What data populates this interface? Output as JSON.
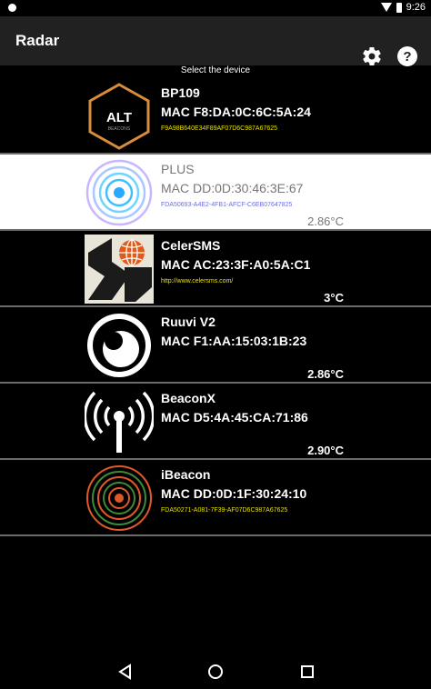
{
  "statusbar": {
    "time": "9:26"
  },
  "appbar": {
    "title": "Radar",
    "icons": [
      "gear-icon",
      "help-icon"
    ]
  },
  "hint": "Select the device",
  "devices": [
    {
      "name": "BP109",
      "mac": "MAC F8:DA:0C:6C:5A:24",
      "extra": "F9A98B640E34F89AF07D6C987A67625",
      "temp": "",
      "icon": "alt-beacons-logo",
      "selected": false,
      "logo_text": "ALT",
      "logo_subtext": "BEACONS"
    },
    {
      "name": "PLUS",
      "mac": "MAC DD:0D:30:46:3E:67",
      "extra": "FDA50693-A4E2-4FB1-AFCF-C6EB07647825",
      "temp": "2.86°C",
      "icon": "pastel-radar-icon",
      "selected": true
    },
    {
      "name": "CelerSMS",
      "mac": "MAC AC:23:3F:A0:5A:C1",
      "extra": "http://www.celersms.com/",
      "temp": "3°C",
      "icon": "celersms-logo",
      "selected": false
    },
    {
      "name": "Ruuvi V2",
      "mac": "MAC F1:AA:15:03:1B:23",
      "extra": "",
      "temp": "2.86°C",
      "icon": "ruuvi-logo",
      "selected": false
    },
    {
      "name": "BeaconX",
      "mac": "MAC D5:4A:45:CA:71:86",
      "extra": "",
      "temp": "2.90°C",
      "icon": "antenna-icon",
      "selected": false
    },
    {
      "name": "iBeacon",
      "mac": "MAC DD:0D:1F:30:24:10",
      "extra": "FDA50271-A081-7F39-AF07D6C987A67625",
      "temp": "",
      "icon": "orange-radar-icon",
      "selected": false
    }
  ],
  "colors": {
    "appbar": "#212121",
    "selected_row": "#ffffff",
    "separator": "#6b6b6b",
    "uuid_text": "#e8e000",
    "uuid_selected": "#6d6fd8",
    "alt_logo": "#d98c3a",
    "ibeacon_logo": "#e0582a"
  },
  "navbar": {
    "icons": [
      "back-icon",
      "home-icon",
      "recents-icon"
    ]
  }
}
